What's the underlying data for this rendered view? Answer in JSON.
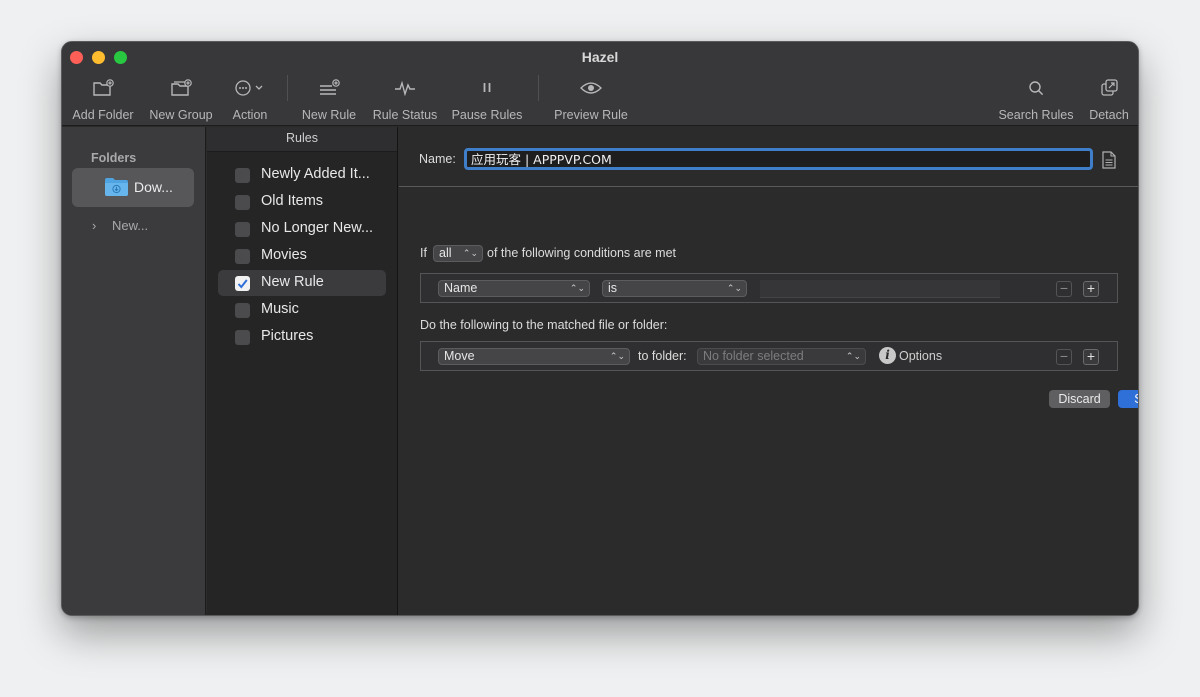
{
  "window": {
    "title": "Hazel"
  },
  "toolbar": {
    "add_folder": "Add Folder",
    "new_group": "New Group",
    "action": "Action",
    "new_rule": "New Rule",
    "rule_status": "Rule Status",
    "pause_rules": "Pause Rules",
    "preview_rule": "Preview Rule",
    "search_rules": "Search Rules",
    "detach": "Detach"
  },
  "sidebar": {
    "header": "Folders",
    "items": [
      {
        "label": "Dow...",
        "selected": true
      },
      {
        "label": "New...",
        "selected": false
      }
    ]
  },
  "rules": {
    "header": "Rules",
    "items": [
      {
        "label": "Newly Added It...",
        "checked": false,
        "selected": false
      },
      {
        "label": "Old Items",
        "checked": false,
        "selected": false
      },
      {
        "label": "No Longer New...",
        "checked": false,
        "selected": false
      },
      {
        "label": "Movies",
        "checked": false,
        "selected": false
      },
      {
        "label": "New Rule",
        "checked": true,
        "selected": true
      },
      {
        "label": "Music",
        "checked": false,
        "selected": false
      },
      {
        "label": "Pictures",
        "checked": false,
        "selected": false
      }
    ]
  },
  "editor": {
    "name_label": "Name:",
    "name_value": "应用玩客 | APPPVP.COM",
    "cond_prefix": "If",
    "cond_match": "all",
    "cond_suffix": "of the following conditions are met",
    "condition": {
      "attribute": "Name",
      "operator": "is",
      "value": ""
    },
    "action_line": "Do the following to the matched file or folder:",
    "action": {
      "verb": "Move",
      "to_folder_label": "to folder:",
      "folder_placeholder": "No folder selected",
      "options_label": "Options"
    },
    "discard": "Discard",
    "save": "Save"
  },
  "colors": {
    "accent": "#2f6fd8",
    "focus_ring": "#3f7fc9",
    "folder": "#4fa3e0"
  }
}
